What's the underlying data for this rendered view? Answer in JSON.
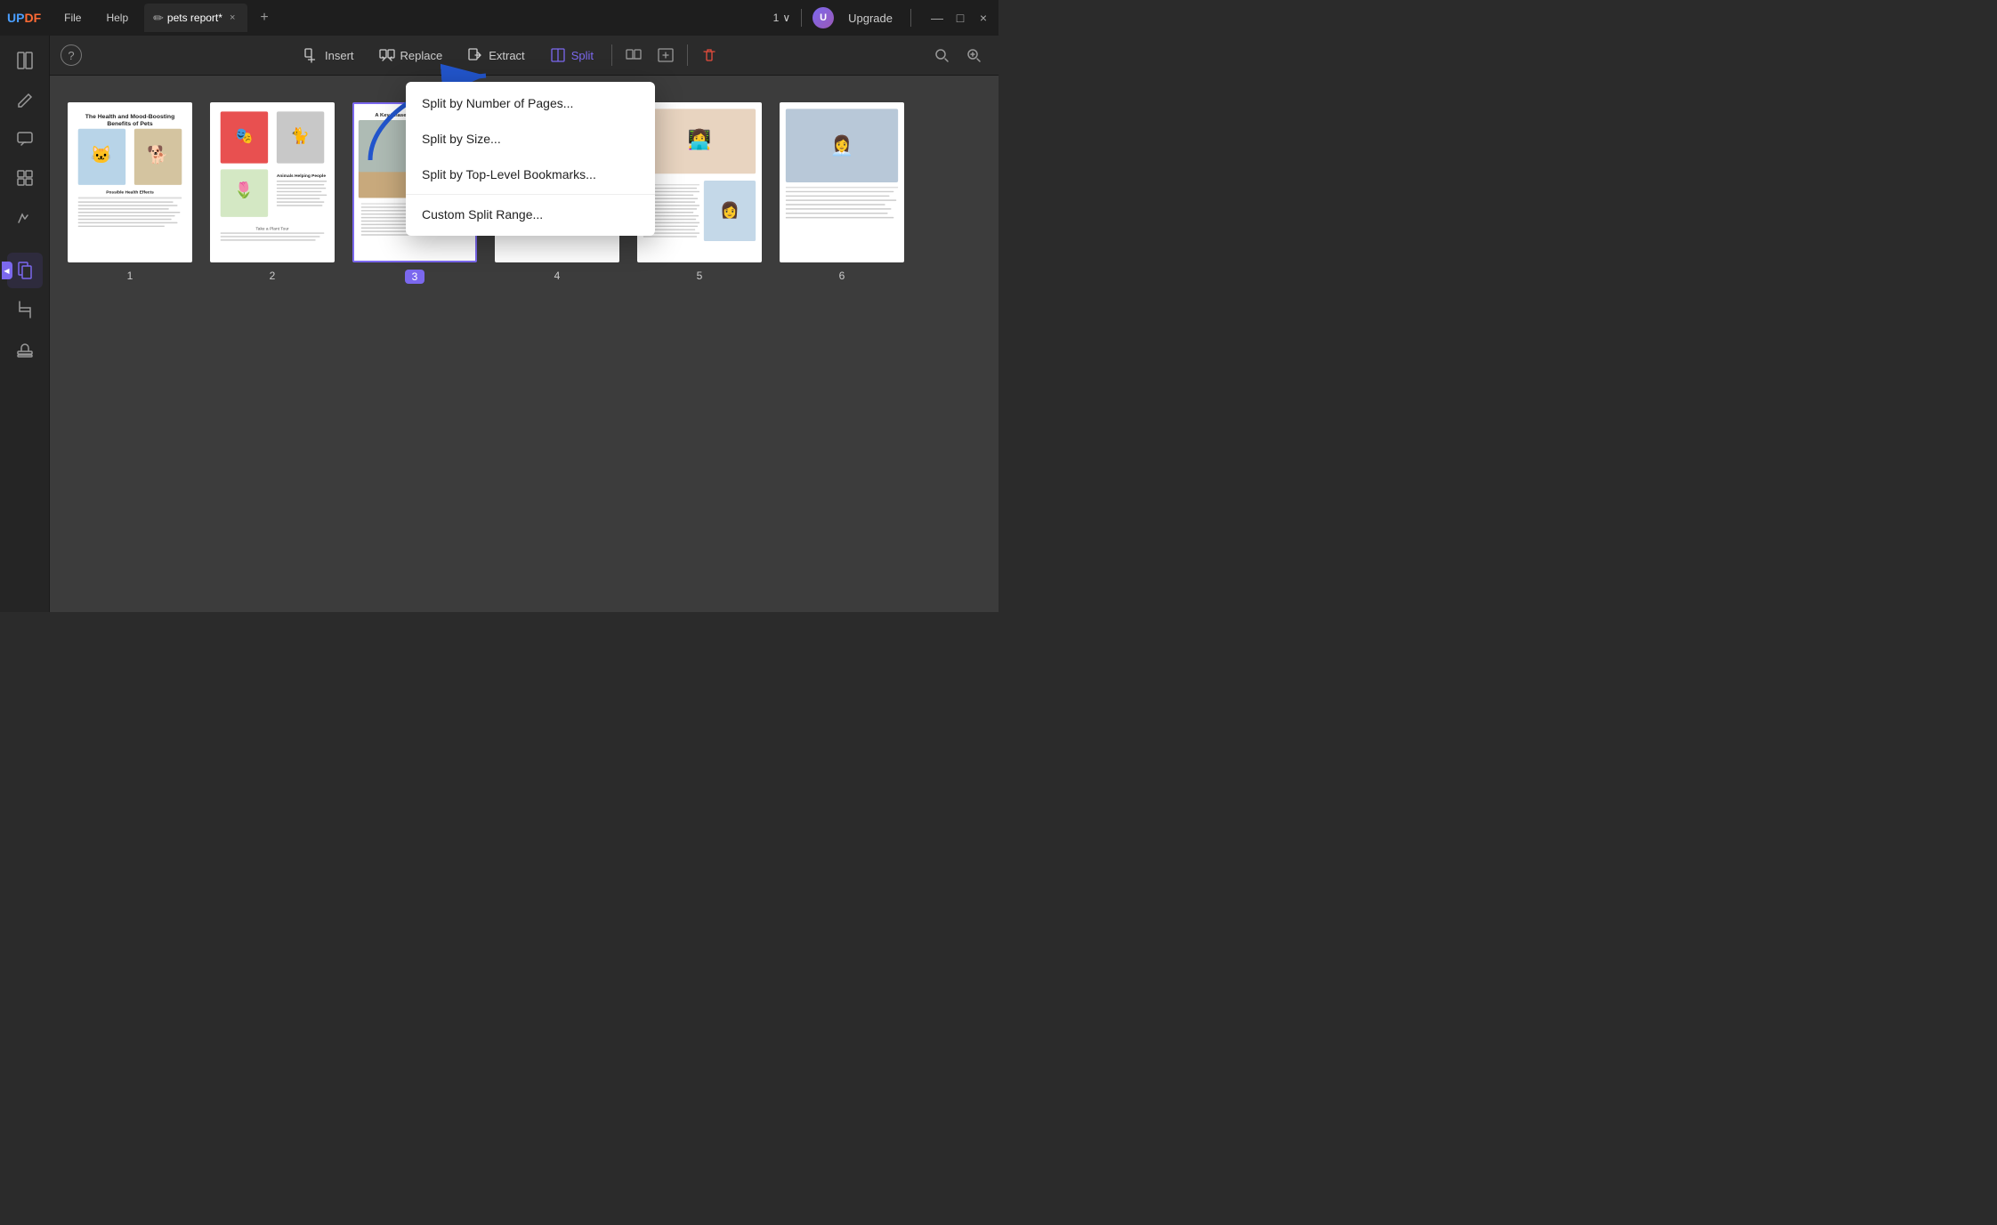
{
  "app": {
    "name": "UPDF",
    "logo_up": "UP",
    "logo_df": "DF"
  },
  "titlebar": {
    "tab_icon": "✏",
    "tab_title": "pets report*",
    "tab_close": "×",
    "tab_add": "+",
    "page_indicator": "1",
    "chevron": "∨",
    "upgrade_label": "Upgrade",
    "user_initial": "U",
    "minimize": "—",
    "maximize": "□",
    "close": "×"
  },
  "toolbar": {
    "help_label": "?",
    "insert_label": "Insert",
    "replace_label": "Replace",
    "extract_label": "Extract",
    "split_label": "Split",
    "search_icon": "🔍",
    "zoom_in": "+"
  },
  "split_menu": {
    "items": [
      "Split by Number of Pages...",
      "Split by Size...",
      "Split by Top-Level Bookmarks...",
      "Custom Split Range..."
    ]
  },
  "sidebar": {
    "icons": [
      {
        "name": "read-icon",
        "symbol": "📖"
      },
      {
        "name": "edit-icon",
        "symbol": "✏"
      },
      {
        "name": "comment-icon",
        "symbol": "💬"
      },
      {
        "name": "organize-icon",
        "symbol": "⊞"
      },
      {
        "name": "signature-icon",
        "symbol": "✍"
      },
      {
        "name": "active-pages-icon",
        "symbol": "📄"
      },
      {
        "name": "crop-icon",
        "symbol": "⊡"
      },
      {
        "name": "stamp-icon",
        "symbol": "🔖"
      }
    ]
  },
  "pages": [
    {
      "num": "1",
      "selected": false
    },
    {
      "num": "2",
      "selected": false
    },
    {
      "num": "3",
      "selected": true
    },
    {
      "num": "4",
      "selected": false
    },
    {
      "num": "5",
      "selected": false
    },
    {
      "num": "6",
      "selected": false
    }
  ]
}
